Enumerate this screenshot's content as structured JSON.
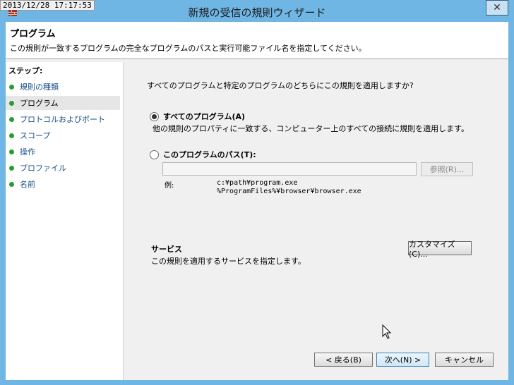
{
  "timestamp": "2013/12/28 17:17:53",
  "window": {
    "title": "新規の受信の規則ウィザード"
  },
  "header": {
    "title": "プログラム",
    "description": "この規則が一致するプログラムの完全なプログラムのパスと実行可能ファイル名を指定してください。"
  },
  "steps": {
    "label": "ステップ:",
    "items": [
      {
        "label": "規則の種類"
      },
      {
        "label": "プログラム"
      },
      {
        "label": "プロトコルおよびポート"
      },
      {
        "label": "スコープ"
      },
      {
        "label": "操作"
      },
      {
        "label": "プロファイル"
      },
      {
        "label": "名前"
      }
    ],
    "current_index": 1
  },
  "main": {
    "question": "すべてのプログラムと特定のプログラムのどちらにこの規則を適用しますか?",
    "option_all": {
      "label": "すべてのプログラム(A)",
      "description": "他の規則のプロパティに一致する、コンピューター上のすべての接続に規則を適用します。",
      "selected": true
    },
    "option_path": {
      "label": "このプログラムのパス(T):",
      "value": "",
      "browse_label": "参照(R)...",
      "selected": false
    },
    "example": {
      "label": "例:",
      "line1": "c:¥path¥program.exe",
      "line2": "%ProgramFiles%¥browser¥browser.exe"
    },
    "services": {
      "title": "サービス",
      "description": "この規則を適用するサービスを指定します。",
      "customize_label": "カスタマイズ(C)..."
    }
  },
  "footer": {
    "back_label": "< 戻る(B)",
    "next_label": "次へ(N) >",
    "cancel_label": "キャンセル"
  },
  "colors": {
    "title_bar": "#6fb6e4",
    "step_dot": "#2e9a2e",
    "step_link": "#1a4e8a"
  },
  "icons": {
    "app": "firewall-icon",
    "close": "close-icon",
    "cursor": "mouse-pointer-icon"
  }
}
